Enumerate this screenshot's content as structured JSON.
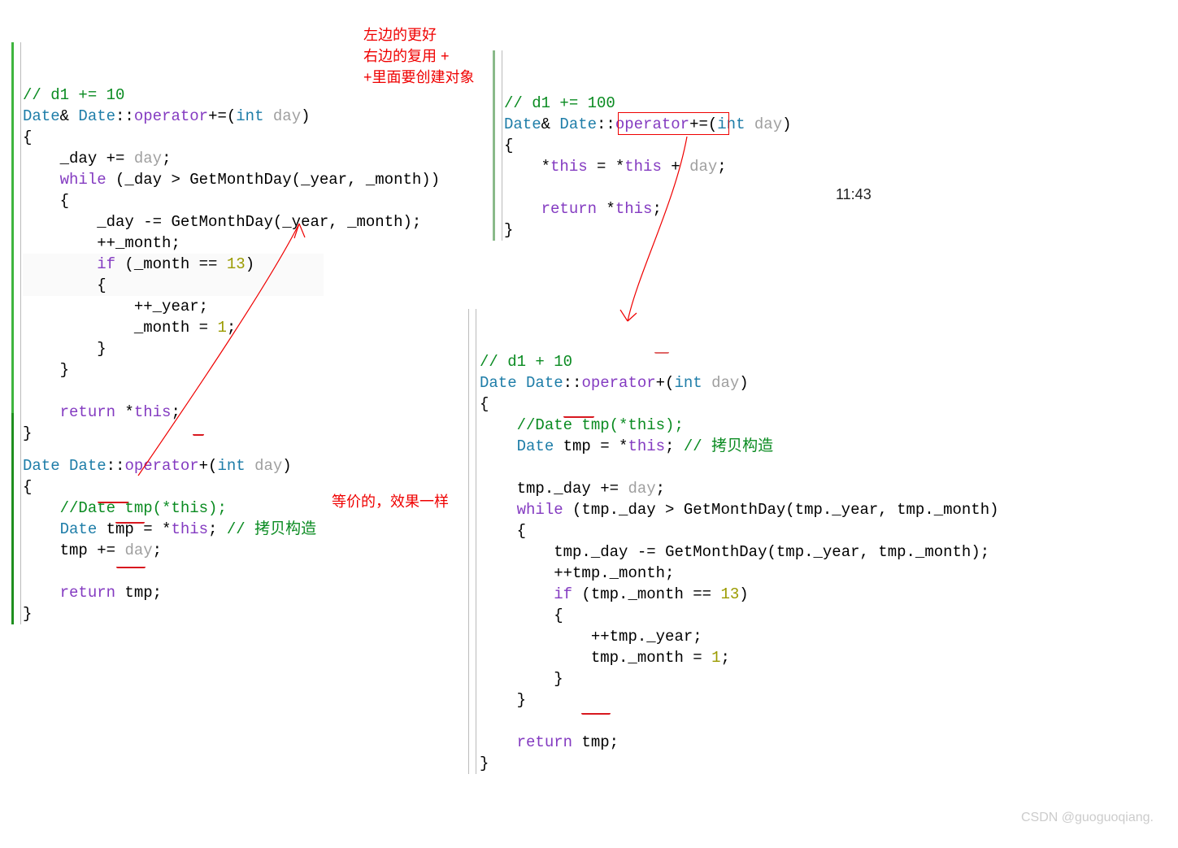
{
  "annotations": {
    "top": {
      "l1": "左边的更好",
      "l2": "右边的复用 +",
      "l3": "+里面要创建对象"
    },
    "mid": "等价的，效果一样"
  },
  "timestamp": "11:43",
  "watermark": "CSDN @guoguoqiang.",
  "left1": {
    "ln1": "// d1 += 10",
    "ln2a": "Date",
    "ln2b": "& ",
    "ln2c": "Date",
    "ln2d": "::",
    "ln2e": "operator",
    "ln2f": "+=(",
    "ln2g": "int",
    "ln2h": " day",
    "ln2i": ")",
    "ln3": "{",
    "ln4": "    _day += day;",
    "ln5": "    while (_day > GetMonthDay(_year, _month))",
    "ln6": "    {",
    "ln7": "        _day -= GetMonthDay(_year, _month);",
    "ln8": "        ++_month;",
    "ln9": "        if (_month == 13)",
    "ln10": "        {",
    "ln11": "            ++_year;",
    "ln12": "            _month = 1;",
    "ln13": "        }",
    "ln14": "    }",
    "ln15": "",
    "ln16a": "    return",
    "ln16b": " *",
    "ln16c": "this",
    "ln16d": ";",
    "ln17": "}"
  },
  "left2": {
    "ln1a": "Date",
    "ln1b": " Date",
    "ln1c": "::",
    "ln1d": "operator",
    "ln1e": "+(",
    "ln1f": "int",
    "ln1g": " day",
    "ln1h": ")",
    "ln2": "{",
    "ln3": "    //Date tmp(*this);",
    "ln4a": "    Date",
    "ln4b": " tmp = *",
    "ln4c": "this",
    "ln4d": "; ",
    "ln4e": "// 拷贝构造",
    "ln5": "    tmp += day;",
    "ln6": "",
    "ln7a": "    return",
    "ln7b": " tmp;",
    "ln8": "}"
  },
  "right1": {
    "ln1": "// d1 += 100",
    "ln2a": "Date",
    "ln2b": "& ",
    "ln2c": "Date",
    "ln2d": "::",
    "ln2e": "operator",
    "ln2f": "+=(",
    "ln2g": "int",
    "ln2h": " day",
    "ln2i": ")",
    "ln3": "{",
    "ln4a": "    *",
    "ln4b": "this",
    "ln4c": " = *",
    "ln4d": "this",
    "ln4e": " + day;",
    "ln5": "",
    "ln6a": "    return",
    "ln6b": " *",
    "ln6c": "this",
    "ln6d": ";",
    "ln7": "}"
  },
  "right2": {
    "ln1": "// d1 + 10",
    "ln2a": "Date",
    "ln2b": " Date",
    "ln2c": "::",
    "ln2d": "operator",
    "ln2e": "+(",
    "ln2f": "int",
    "ln2g": " day",
    "ln2h": ")",
    "ln3": "{",
    "ln4": "    //Date tmp(*this);",
    "ln5a": "    Date",
    "ln5b": " tmp = *",
    "ln5c": "this",
    "ln5d": "; ",
    "ln5e": "// 拷贝构造",
    "ln6": "",
    "ln7": "    tmp._day += day;",
    "ln8": "    while (tmp._day > GetMonthDay(tmp._year, tmp._month)",
    "ln9": "    {",
    "ln10": "        tmp._day -= GetMonthDay(tmp._year, tmp._month);",
    "ln11": "        ++tmp._month;",
    "ln12": "        if (tmp._month == 13)",
    "ln13": "        {",
    "ln14": "            ++tmp._year;",
    "ln15": "            tmp._month = 1;",
    "ln16": "        }",
    "ln17": "    }",
    "ln18": "",
    "ln19a": "    return",
    "ln19b": " tmp;",
    "ln20": "}"
  }
}
